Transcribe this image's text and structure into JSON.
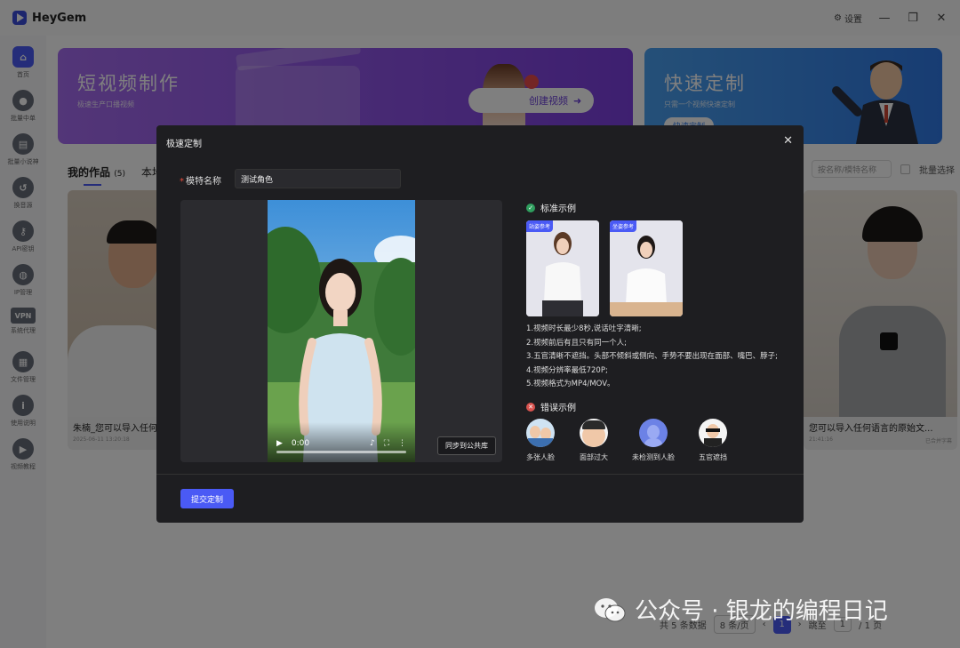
{
  "app": {
    "name": "HeyGem",
    "settings_label": "设置"
  },
  "sidebar": {
    "items": [
      {
        "label": "首页",
        "icon": "home-icon",
        "glyph": "⌂",
        "active": true
      },
      {
        "label": "批量中单",
        "icon": "tag-icon",
        "glyph": "●"
      },
      {
        "label": "批量小说神",
        "icon": "book-icon",
        "glyph": "▤"
      },
      {
        "label": "换音源",
        "icon": "undo-icon",
        "glyph": "↺"
      },
      {
        "label": "API密钥",
        "icon": "key-icon",
        "glyph": "⚷"
      },
      {
        "label": "IP管理",
        "icon": "globe-icon",
        "glyph": "◍"
      },
      {
        "label": "系统代理",
        "icon": "vpn-icon",
        "glyph": "VPN"
      },
      {
        "label": "文件管理",
        "icon": "file-icon",
        "glyph": "▦"
      },
      {
        "label": "使用说明",
        "icon": "info-icon",
        "glyph": "i"
      },
      {
        "label": "视频教程",
        "icon": "video-icon",
        "glyph": "▶"
      }
    ]
  },
  "banners": {
    "left": {
      "title": "短视频制作",
      "subtitle": "极速生产口播视频",
      "button": "创建视频"
    },
    "right": {
      "title": "快速定制",
      "subtitle": "只需一个视频快速定制",
      "button": "快速定制"
    }
  },
  "tabs": {
    "works": "我的作品",
    "works_count": "(5)",
    "local": "本地"
  },
  "toolbar": {
    "search_placeholder": "按名称/模特名称",
    "batch_select": "批量选择"
  },
  "cards": [
    {
      "title": "朱楠_您可以导入任何语",
      "date": "2025-06-11 13:20:18"
    },
    {
      "title": "您可以导入任何语言的原始文...",
      "date": "21:41:16",
      "status": "已合并字幕"
    }
  ],
  "pager": {
    "total": "共 5 条数据",
    "per_page": "8 条/页",
    "page": "1",
    "goto": "跳至",
    "page_suffix": "/ 1 页"
  },
  "modal": {
    "title": "极速定制",
    "name_label": "模特名称",
    "name_value": "测试角色",
    "video_time": "0:00",
    "sync_button": "同步到公共库",
    "standard_title": "标准示例",
    "sample_tags": [
      "站姿参考",
      "坐姿参考"
    ],
    "rules": [
      "1.视频时长最少8秒,说话吐字清晰;",
      "2.视频前后有且只有同一个人;",
      "3.五官清晰不遮挡。头部不倾斜或侧向、手势不要出现在面部、嘴巴、脖子;",
      "4.视频分辨率最低720P;",
      "5.视频格式为MP4/MOV。"
    ],
    "error_title": "错误示例",
    "error_items": [
      "多张人脸",
      "面部过大",
      "未检测到人脸",
      "五官遮挡"
    ],
    "submit": "提交定制"
  },
  "watermark": "公众号 · 银龙的编程日记"
}
